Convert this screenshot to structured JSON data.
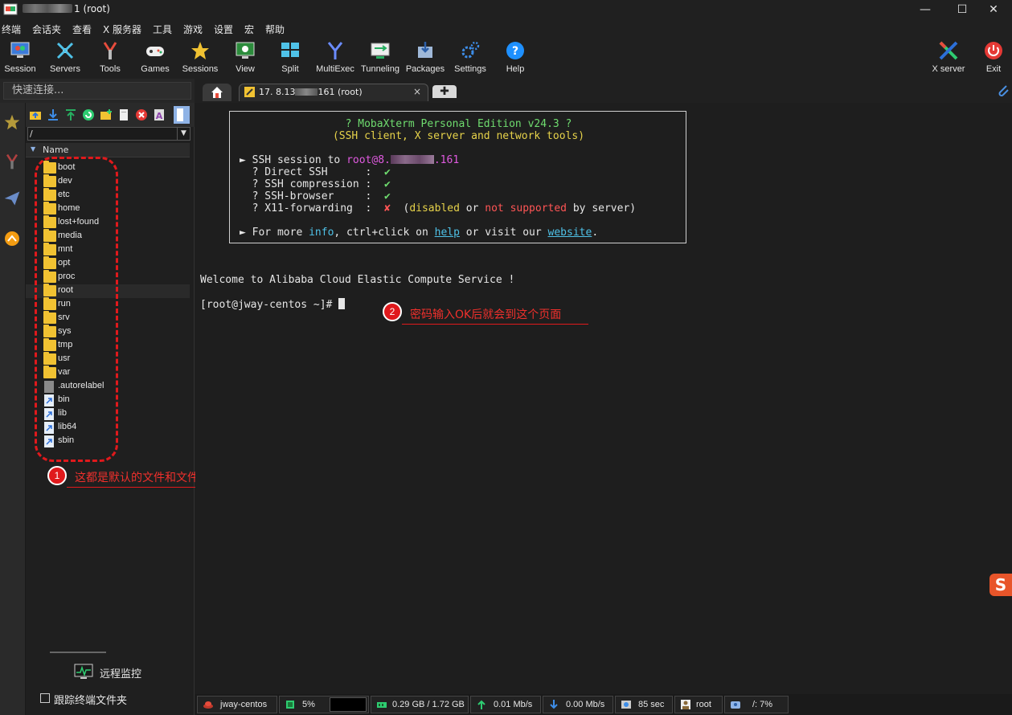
{
  "window": {
    "title_suffix": "1 (root)",
    "minimize": "—",
    "maximize": "☐",
    "close": "✕"
  },
  "menu": [
    "终端",
    "会话夹",
    "查看",
    "X 服务器",
    "工具",
    "游戏",
    "设置",
    "宏",
    "帮助"
  ],
  "toolbar": {
    "session": "Session",
    "servers": "Servers",
    "tools": "Tools",
    "games": "Games",
    "sessions": "Sessions",
    "view": "View",
    "split": "Split",
    "multiexec": "MultiExec",
    "tunneling": "Tunneling",
    "packages": "Packages",
    "settings": "Settings",
    "help": "Help",
    "xserver": "X server",
    "exit": "Exit"
  },
  "quick_connect": {
    "placeholder": "快速连接..."
  },
  "tabs": {
    "session_tab": "17. 8.13",
    "session_tab_end": "161 (root)",
    "close": "×",
    "plus": "✚"
  },
  "file_panel": {
    "path": "/",
    "column_header": "Name",
    "items": [
      {
        "name": "boot",
        "type": "folder"
      },
      {
        "name": "dev",
        "type": "folder"
      },
      {
        "name": "etc",
        "type": "folder"
      },
      {
        "name": "home",
        "type": "folder"
      },
      {
        "name": "lost+found",
        "type": "folder"
      },
      {
        "name": "media",
        "type": "folder"
      },
      {
        "name": "mnt",
        "type": "folder"
      },
      {
        "name": "opt",
        "type": "folder"
      },
      {
        "name": "proc",
        "type": "folder"
      },
      {
        "name": "root",
        "type": "folder"
      },
      {
        "name": "run",
        "type": "folder"
      },
      {
        "name": "srv",
        "type": "folder"
      },
      {
        "name": "sys",
        "type": "folder"
      },
      {
        "name": "tmp",
        "type": "folder"
      },
      {
        "name": "usr",
        "type": "folder"
      },
      {
        "name": "var",
        "type": "folder"
      },
      {
        "name": ".autorelabel",
        "type": "file"
      },
      {
        "name": "bin",
        "type": "link"
      },
      {
        "name": "lib",
        "type": "link"
      },
      {
        "name": "lib64",
        "type": "link"
      },
      {
        "name": "sbin",
        "type": "link"
      }
    ],
    "remote_monitor": "远程监控",
    "follow_terminal_folder": "跟踪终端文件夹"
  },
  "annotations": {
    "one_num": "1",
    "one_text": "这都是默认的文件和文件夹",
    "two_num": "2",
    "two_text": "密码输入OK后就会到这个页面"
  },
  "terminal": {
    "banner_title": "? MobaXterm Personal Edition v24.3 ?",
    "banner_sub": "(SSH client, X server and network tools)",
    "ssh_session_prefix": "► SSH session to ",
    "ssh_target_a": "root@8.",
    "ssh_target_b": ".161",
    "direct_ssh": "  ? Direct SSH      :  ",
    "ssh_compression": "  ? SSH compression :  ",
    "ssh_browser": "  ? SSH-browser     :  ",
    "x11_forwarding": "  ? X11-forwarding  :  ",
    "check": "✔",
    "cross": "✘",
    "x11_open": "  (",
    "disabled": "disabled",
    "or": " or ",
    "not_supported": "not supported",
    "by_server": " by server)",
    "more_info_prefix": "► For more ",
    "info": "info",
    "ctrl_click": ", ctrl+click on ",
    "help": "help",
    "or_visit": " or visit our ",
    "website": "website",
    "dot": ".",
    "welcome": "Welcome to Alibaba Cloud Elastic Compute Service !",
    "prompt": "[root@jway-centos ~]# "
  },
  "statusbar": {
    "host": "jway-centos",
    "cpu": "5%",
    "memory": "0.29 GB / 1.72 GB",
    "upload": "0.01 Mb/s",
    "download": "0.00 Mb/s",
    "uptime": "85 sec",
    "user": "root",
    "disk": "/: 7%"
  },
  "colors": {
    "accent_red": "#e0191c",
    "folder": "#f1c232",
    "terminal_green": "#6fdc6f",
    "terminal_yellow": "#e6d24a",
    "terminal_magenta": "#e05ae0",
    "terminal_cyan": "#4fc2e8"
  }
}
